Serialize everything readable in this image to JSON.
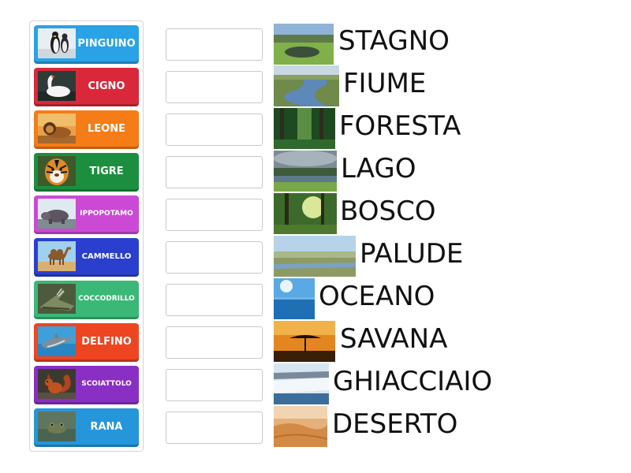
{
  "animals": [
    {
      "label": "PINGUINO",
      "icon": "penguin-photo-icon",
      "color": "#29a3e6"
    },
    {
      "label": "CIGNO",
      "icon": "swan-photo-icon",
      "color": "#d9283a"
    },
    {
      "label": "LEONE",
      "icon": "lion-photo-icon",
      "color": "#f57c16"
    },
    {
      "label": "TIGRE",
      "icon": "tiger-photo-icon",
      "color": "#1b8f3f"
    },
    {
      "label": "IPPOPOTAMO",
      "icon": "hippo-photo-icon",
      "color": "#cc49d6"
    },
    {
      "label": "CAMMELLO",
      "icon": "camel-photo-icon",
      "color": "#2b3fcf"
    },
    {
      "label": "COCCODRILLO",
      "icon": "crocodile-photo-icon",
      "color": "#3bb878"
    },
    {
      "label": "DELFINO",
      "icon": "dolphin-photo-icon",
      "color": "#ee4521"
    },
    {
      "label": "SCOIATTOLO",
      "icon": "squirrel-photo-icon",
      "color": "#8a2fc4"
    },
    {
      "label": "RANA",
      "icon": "frog-photo-icon",
      "color": "#2596d9"
    }
  ],
  "habitats": [
    {
      "label": "STAGNO",
      "icon": "pond-photo-icon"
    },
    {
      "label": "FIUME",
      "icon": "river-photo-icon"
    },
    {
      "label": "FORESTA",
      "icon": "forest-photo-icon"
    },
    {
      "label": "LAGO",
      "icon": "lake-photo-icon"
    },
    {
      "label": "BOSCO",
      "icon": "woods-photo-icon"
    },
    {
      "label": "PALUDE",
      "icon": "swamp-photo-icon"
    },
    {
      "label": "OCEANO",
      "icon": "ocean-photo-icon"
    },
    {
      "label": "SAVANA",
      "icon": "savanna-photo-icon"
    },
    {
      "label": "GHIACCIAIO",
      "icon": "glacier-photo-icon"
    },
    {
      "label": "DESERTO",
      "icon": "desert-photo-icon"
    }
  ]
}
